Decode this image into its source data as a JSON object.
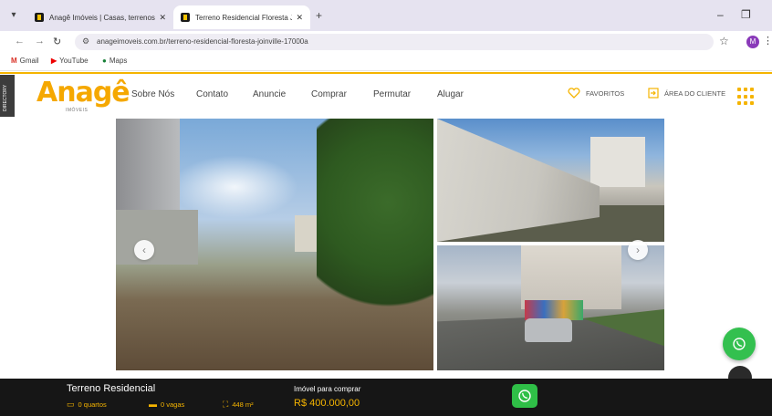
{
  "browser": {
    "tabs": [
      {
        "title": "Anagê Imóveis | Casas, terrenos",
        "active": false
      },
      {
        "title": "Terreno Residencial Floresta Jo...",
        "active": true
      }
    ],
    "url": "anageimoveis.com.br/terreno-residencial-floresta-joinville-17000a",
    "profile_initial": "M",
    "bookmarks": [
      {
        "label": "Gmail",
        "icon": "gmail-icon"
      },
      {
        "label": "YouTube",
        "icon": "youtube-icon"
      },
      {
        "label": "Maps",
        "icon": "maps-icon"
      }
    ]
  },
  "site": {
    "side_tab": "DIRECTORY",
    "logo_text": "Anagê",
    "logo_sub": "IMÓVEIS",
    "menu": [
      "Sobre Nós",
      "Contato",
      "Anuncie",
      "Comprar",
      "Permutar",
      "Alugar"
    ],
    "favorites_label": "FAVORITOS",
    "client_area_label": "ÁREA DO CLIENTE",
    "accent_color": "#f5b400"
  },
  "listing": {
    "title": "Terreno Residencial",
    "bedrooms": "0 quartos",
    "parking": "0 vagas",
    "area": "448 m²",
    "price_label": "Imóvel para comprar",
    "price": "R$ 400.000,00"
  },
  "colors": {
    "whatsapp": "#33c04f",
    "bottom_bar": "#161616"
  }
}
